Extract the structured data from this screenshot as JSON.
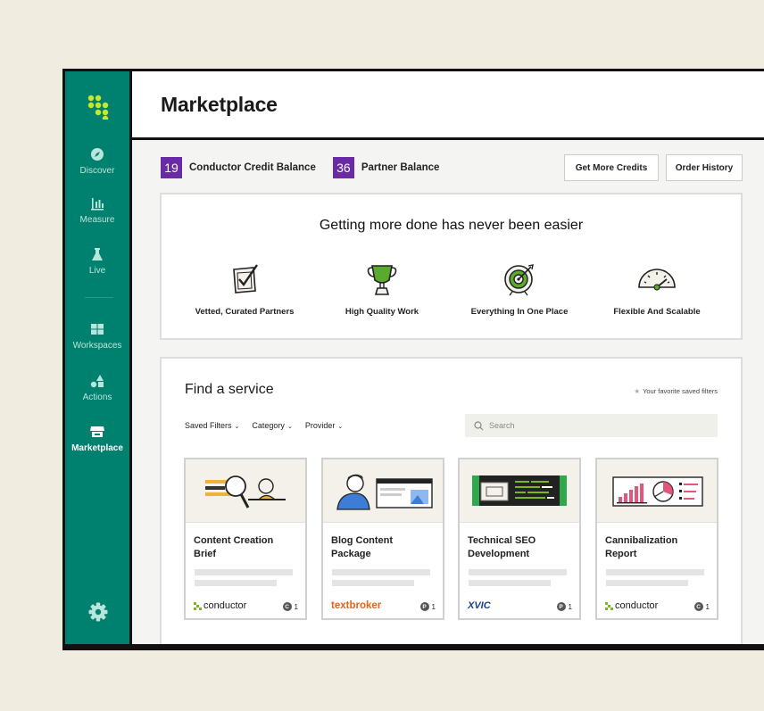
{
  "sidebar": {
    "items": [
      {
        "label": "Discover",
        "icon": "compass-icon"
      },
      {
        "label": "Measure",
        "icon": "bar-chart-icon"
      },
      {
        "label": "Live",
        "icon": "flask-icon"
      },
      {
        "label": "Workspaces",
        "icon": "grid-icon"
      },
      {
        "label": "Actions",
        "icon": "shapes-icon"
      },
      {
        "label": "Marketplace",
        "icon": "store-icon"
      }
    ],
    "settings_icon": "gear-icon"
  },
  "header": {
    "title": "Marketplace"
  },
  "balances": {
    "conductor_credit": {
      "value": "19",
      "label": "Conductor Credit Balance"
    },
    "partner": {
      "value": "36",
      "label": "Partner Balance"
    }
  },
  "buttons": {
    "get_more_credits": "Get More Credits",
    "order_history": "Order History"
  },
  "benefits": {
    "heading": "Getting more done has never been easier",
    "items": [
      {
        "label": "Vetted, Curated Partners",
        "icon": "checkbox-icon"
      },
      {
        "label": "High Quality Work",
        "icon": "trophy-icon"
      },
      {
        "label": "Everything In One Place",
        "icon": "target-icon"
      },
      {
        "label": "Flexible And Scalable",
        "icon": "gauge-icon"
      }
    ]
  },
  "services": {
    "heading": "Find a service",
    "favorites_text": "Your favorite saved filters",
    "filters": [
      "Saved Filters",
      "Category",
      "Provider"
    ],
    "search_placeholder": "Search",
    "cards": [
      {
        "title": "Content Creation Brief",
        "provider": "conductor",
        "cost_letter": "C",
        "cost": "1"
      },
      {
        "title": "Blog Content Package",
        "provider": "textbroker",
        "cost_letter": "P",
        "cost": "1"
      },
      {
        "title": "Technical SEO Development",
        "provider": "XVIC",
        "cost_letter": "P",
        "cost": "1"
      },
      {
        "title": "Cannibalization Report",
        "provider": "conductor",
        "cost_letter": "C",
        "cost": "1"
      }
    ]
  },
  "colors": {
    "sidebar": "#00806e",
    "badge": "#6a2aa6",
    "logo": "#c6e82a",
    "textbroker": "#e0651b"
  }
}
